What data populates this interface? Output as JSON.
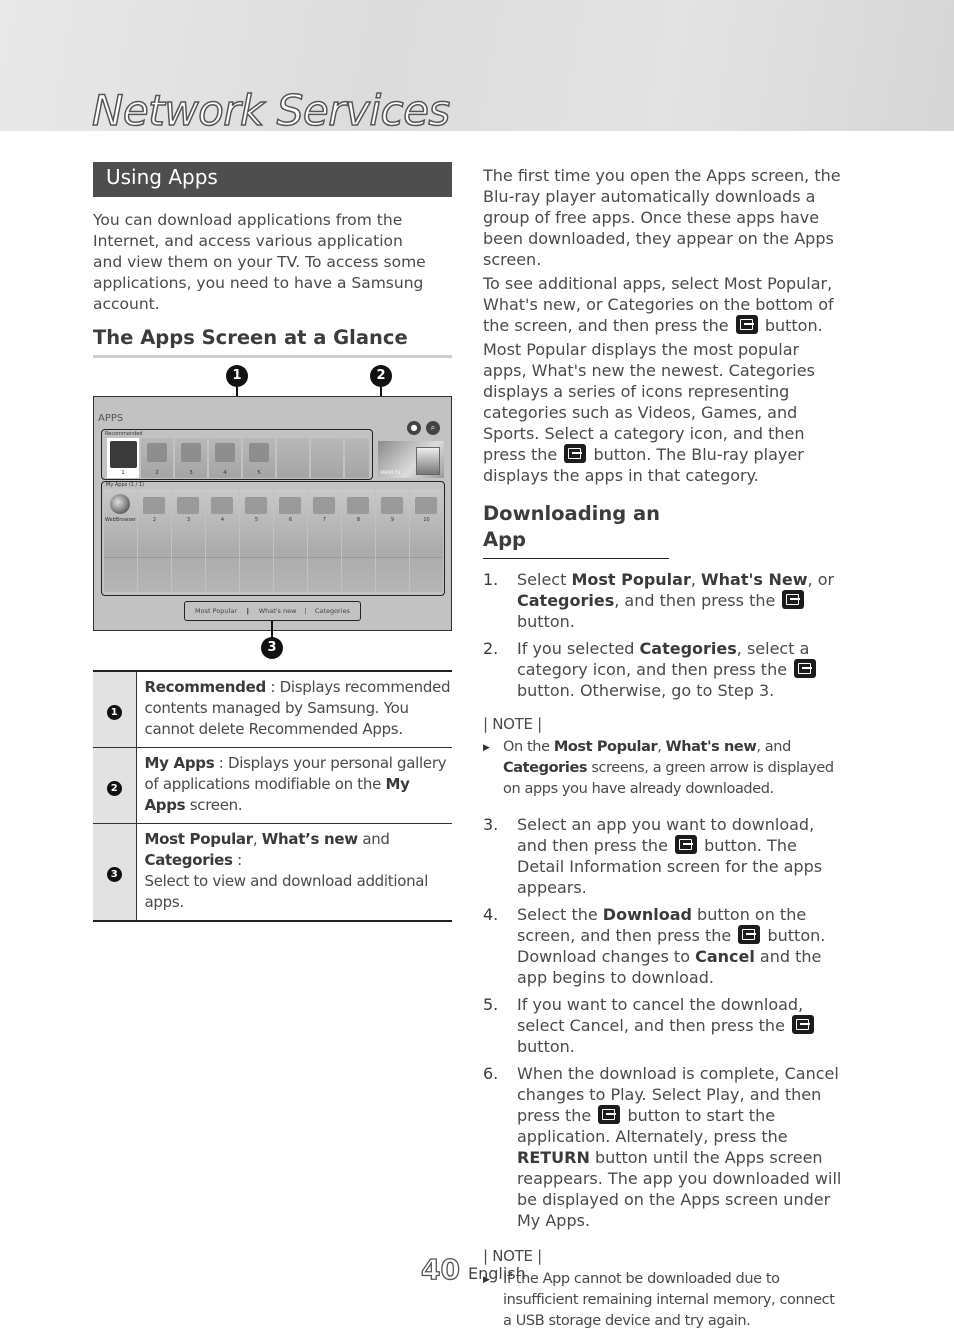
{
  "header": {
    "title": "Network Services"
  },
  "left": {
    "section_title": "Using Apps",
    "intro": "You can download applications from the Internet, and access various application and view them on your TV. To access some applications, you need to have a Samsung account.",
    "subheading": "The Apps Screen at a Glance",
    "diagram": {
      "callouts": [
        "1",
        "2",
        "3"
      ],
      "apps_label": "APPS",
      "recommended_label": "Recommended",
      "recommended_tiles": [
        "1",
        "2",
        "3",
        "4",
        "5",
        "",
        "",
        ""
      ],
      "smart_tv_label": "SMART TV",
      "icons": [
        "user-icon",
        "search-icon"
      ],
      "my_apps_label": "My Apps (1 / 1)",
      "my_apps_tiles": [
        "WebBrowser",
        "2",
        "3",
        "4",
        "5",
        "6",
        "7",
        "8",
        "9",
        "10"
      ],
      "bottom_nav": [
        "Most Popular",
        "What's new",
        "Categories"
      ]
    },
    "legend": [
      {
        "num": "1",
        "term": "Recommended",
        "sep": " : ",
        "text": "Displays recommended contents managed by Samsung. You cannot delete Recommended Apps."
      },
      {
        "num": "2",
        "term": "My Apps",
        "sep": " : ",
        "text": "Displays your personal gallery of applications modifiable on the ",
        "term2": "My Apps",
        "text2": " screen."
      },
      {
        "num": "3",
        "term": "Most Popular",
        "c1": ", ",
        "term2": "What’s new",
        "c2": " and ",
        "term3": "Categories",
        "sep": " : ",
        "text": "Select to view and download additional apps."
      }
    ]
  },
  "right": {
    "para1": "The first time you open the Apps screen, the Blu-ray player automatically downloads  a group of free apps. Once these apps have been downloaded, they appear on the Apps screen.",
    "para2_a": "To see additional apps, select Most Popular, What's new, or Categories on the bottom of the screen, and then press the",
    "para2_b": "button.",
    "para3_a": "Most Popular displays the most popular apps, What's new the newest. Categories displays a series of icons representing categories such as Videos, Games, and Sports. Select a category icon, and then press the",
    "para3_b": "button. The Blu-ray player displays the apps in that category.",
    "subheading": "Downloading an App",
    "steps": [
      {
        "num": "1.",
        "parts": [
          "Select ",
          "Most Popular",
          ", ",
          "What's New",
          ", or ",
          "Categories",
          ", and then press the",
          "button."
        ]
      },
      {
        "num": "2.",
        "parts": [
          "If you selected ",
          "Categories",
          ", select a category icon, and then press the",
          "button. Otherwise, go to Step 3."
        ]
      },
      {
        "num": "3.",
        "parts": [
          "Select an app you want to download, and then press the",
          "button. The Detail Information screen for the apps appears."
        ]
      },
      {
        "num": "4.",
        "parts": [
          "Select the ",
          "Download",
          " button on the screen, and then press the",
          "button. Download changes to ",
          "Cancel",
          " and the app begins to download."
        ]
      },
      {
        "num": "5.",
        "parts": [
          "If you want to cancel the download, select Cancel, and then press the",
          "button."
        ]
      },
      {
        "num": "6.",
        "parts": [
          "When the download is complete, Cancel changes to Play. Select Play, and then press the",
          "button to start the application. Alternately, press the ",
          "RETURN",
          " button until the Apps screen reappears. The app you downloaded will be displayed on the Apps screen under My Apps."
        ]
      }
    ],
    "note1": {
      "head": "| NOTE |",
      "parts": [
        "On the ",
        "Most Popular",
        ", ",
        "What's new",
        ", and ",
        "Categories",
        " screens, a green arrow is displayed on apps you have already downloaded."
      ]
    },
    "note2": {
      "head": "| NOTE |",
      "text": "If the App cannot be downloaded due to insufficient remaining internal memory, connect a USB storage device and try again."
    }
  },
  "footer": {
    "page_number": "40",
    "language": "English"
  }
}
